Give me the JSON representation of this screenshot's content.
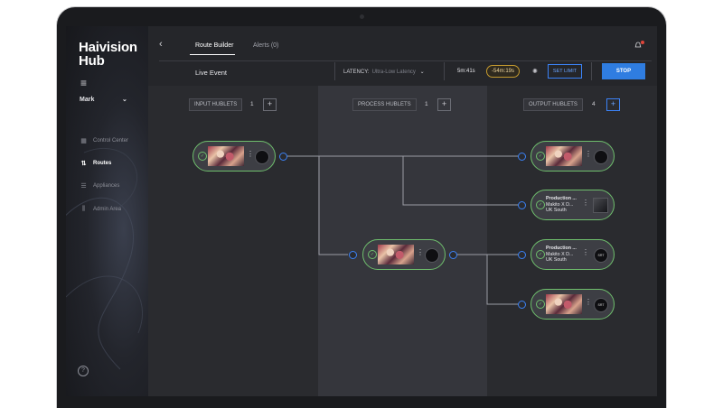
{
  "brand": {
    "line1": "Haivision",
    "line2": "Hub"
  },
  "sidebar": {
    "user": "Mark",
    "items": [
      {
        "label": "Control Center",
        "icon": "grid-icon"
      },
      {
        "label": "Routes",
        "icon": "routes-icon",
        "active": true
      },
      {
        "label": "Appliances",
        "icon": "appliances-icon"
      },
      {
        "label": "Admin Area",
        "icon": "sliders-icon"
      }
    ],
    "help": "?"
  },
  "tabs": [
    {
      "label": "Route Builder",
      "active": true
    },
    {
      "label": "Alerts (0)"
    }
  ],
  "event": {
    "name": "Live Event",
    "latency_label": "LATENCY:",
    "latency_value": "Ultra-Low Latency",
    "elapsed": "5m:41s",
    "remaining": "-54m:19s",
    "set_limit": "SET LIMIT",
    "stop": "STOP"
  },
  "columns": [
    {
      "label": "INPUT HUBLETS",
      "count": "1"
    },
    {
      "label": "PROCESS HUBLETS",
      "count": "1"
    },
    {
      "label": "OUTPUT HUBLETS",
      "count": "4"
    }
  ],
  "outputs": [
    {
      "title": "Production ...",
      "subtitle": "Makito X D...",
      "location": "UK South"
    },
    {
      "title": "Production ...",
      "subtitle": "Makito X D...",
      "location": "UK South"
    }
  ],
  "logo_text": "SRT",
  "colors": {
    "accent": "#2f7de1",
    "status_ok": "#6fbf6d",
    "timer_warn": "#c49a2f"
  }
}
